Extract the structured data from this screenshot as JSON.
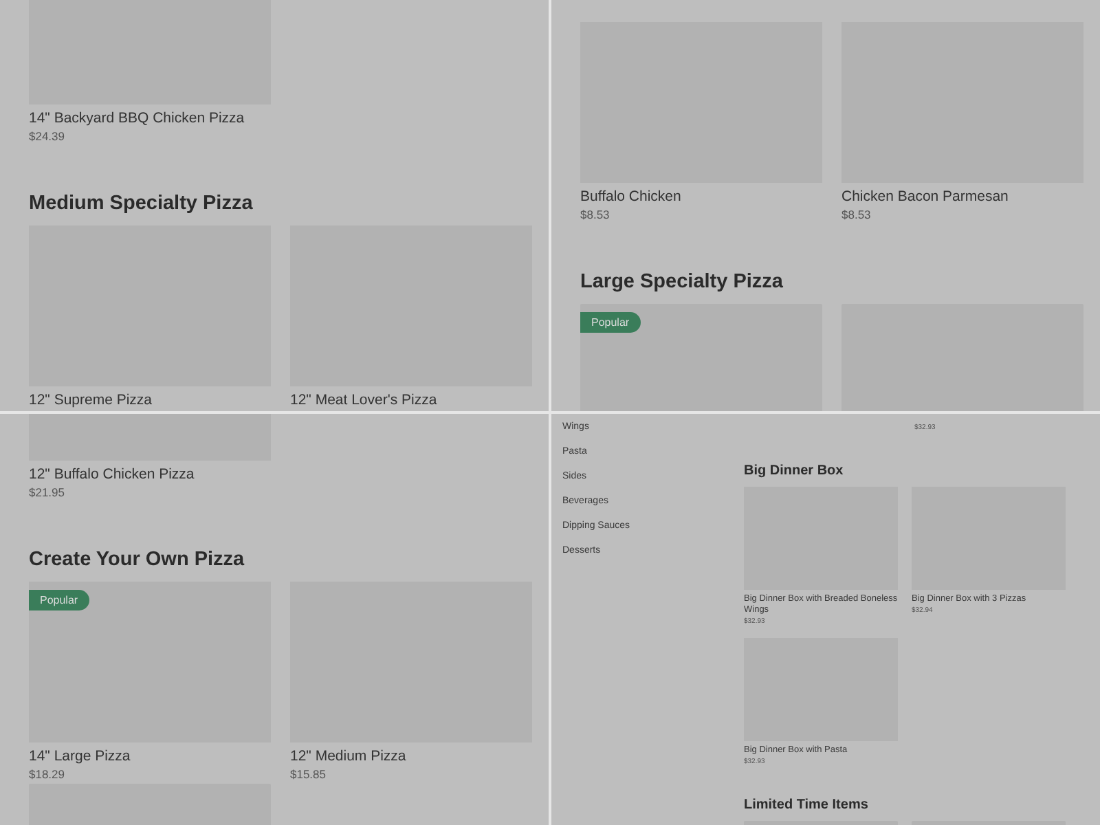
{
  "panels": [
    {
      "kind": "menu",
      "blocks": [
        {
          "kind": "cards",
          "cards": [
            {
              "name": "14\" Backyard BBQ Chicken Pizza",
              "price": "$24.39"
            }
          ]
        },
        {
          "kind": "heading",
          "text": "Medium Specialty Pizza"
        },
        {
          "kind": "cards",
          "cards": [
            {
              "name": "12\" Supreme Pizza"
            },
            {
              "name": "12\" Meat Lover's Pizza"
            }
          ]
        }
      ]
    },
    {
      "kind": "menu",
      "blocks": [
        {
          "kind": "cards",
          "cards": [
            {
              "name": "Buffalo Chicken",
              "price": "$8.53"
            },
            {
              "name": "Chicken Bacon Parmesan",
              "price": "$8.53"
            }
          ]
        },
        {
          "kind": "heading",
          "text": "Large Specialty Pizza"
        },
        {
          "kind": "cards",
          "cards": [
            {
              "kind": "image_only",
              "badge": "Popular"
            },
            {
              "kind": "image_only"
            }
          ]
        }
      ]
    },
    {
      "kind": "menu",
      "blocks": [
        {
          "kind": "cards",
          "cards": [
            {
              "name": "12\" Buffalo Chicken Pizza",
              "price": "$21.95"
            }
          ]
        },
        {
          "kind": "heading",
          "text": "Create Your Own Pizza"
        },
        {
          "kind": "cards",
          "cards": [
            {
              "badge": "Popular",
              "name": "14\" Large Pizza",
              "price": "$18.29"
            },
            {
              "name": "12\" Medium Pizza",
              "price": "$15.85"
            }
          ]
        },
        {
          "kind": "cards",
          "cards": [
            {
              "kind": "image_only"
            }
          ]
        }
      ]
    },
    {
      "kind": "sidebar",
      "categories": [
        "Wings",
        "Pasta",
        "Sides",
        "Beverages",
        "Dipping Sauces",
        "Desserts"
      ],
      "blocks": [
        {
          "kind": "partial",
          "cells": [
            {
              "price": "$32.93"
            }
          ]
        },
        {
          "kind": "heading",
          "text": "Big Dinner Box"
        },
        {
          "kind": "cards",
          "cards": [
            {
              "name": "Big Dinner Box with Breaded Boneless Wings",
              "price": "$32.93"
            },
            {
              "name": "Big Dinner Box with 3 Pizzas",
              "price": "$32.94"
            },
            {
              "name": "Big Dinner Box with Pasta",
              "price": "$32.93"
            }
          ]
        },
        {
          "kind": "heading",
          "text": "Limited Time Items"
        },
        {
          "kind": "cards",
          "cards": [
            {
              "kind": "image_only"
            },
            {
              "kind": "image_only"
            }
          ]
        }
      ]
    }
  ]
}
